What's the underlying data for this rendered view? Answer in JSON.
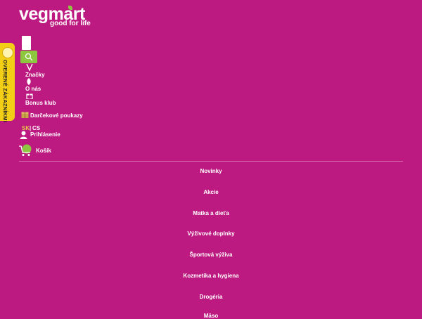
{
  "brand": {
    "name": "vegmart",
    "tagline": "good for life"
  },
  "search": {
    "placeholder": ""
  },
  "side_tab": {
    "label": "OVERENÉ ZÁKAZNÍKMI"
  },
  "nav": {
    "brands": "Značky",
    "about": "O nás",
    "bonus": "Bonus klub",
    "vouchers": "Darčekové poukazy",
    "lang_current": "SK",
    "lang_other": "CS",
    "login": "Prihlásenie",
    "cart": "Košík"
  },
  "categories": [
    "Novinky",
    "Akcie",
    "Matka a dieťa",
    "Výživové doplnky",
    "Športová výživa",
    "Kozmetika a hygiena",
    "Drogéria",
    "Mäso"
  ],
  "colors": {
    "background": "#bd1a81",
    "accent_green": "#8dc63f",
    "badge_yellow": "#f3ce17"
  }
}
